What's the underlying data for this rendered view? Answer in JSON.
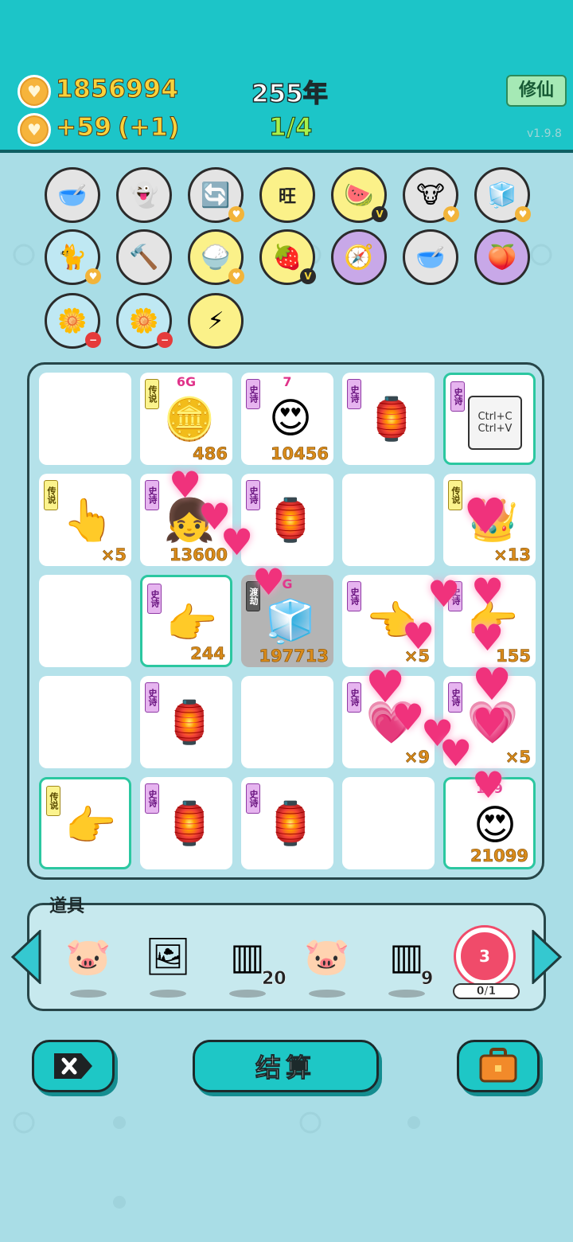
{
  "header": {
    "coins": "1856994",
    "income": "+59",
    "income_bonus": "(+1)",
    "year": "255年",
    "progress": "1/4",
    "cultivate_label": "修仙",
    "version": "v1.9.8"
  },
  "abilities": [
    {
      "name": "dog-food-bowl-icon",
      "glyph": "🥣",
      "bg": "gray",
      "badge": ""
    },
    {
      "name": "ghost-icon",
      "glyph": "👻",
      "bg": "gray",
      "badge": ""
    },
    {
      "name": "refresh-icon",
      "glyph": "🔄",
      "bg": "gray",
      "badge": "h"
    },
    {
      "name": "wang-text-icon",
      "glyph": "旺",
      "bg": "yellow",
      "badge": ""
    },
    {
      "name": "fruit-platter-icon",
      "glyph": "🍉",
      "bg": "yellow",
      "badge": "v"
    },
    {
      "name": "cow-toys-icon",
      "glyph": "🐮",
      "bg": "gray",
      "badge": "h"
    },
    {
      "name": "sugar-cubes-icon",
      "glyph": "🧊",
      "bg": "gray",
      "badge": "h"
    },
    {
      "name": "cat-back-icon",
      "glyph": "🐈",
      "bg": "blue",
      "badge": "h"
    },
    {
      "name": "hammer-icon",
      "glyph": "🔨",
      "bg": "gray",
      "badge": ""
    },
    {
      "name": "rice-bowl-icon",
      "glyph": "🍚",
      "bg": "yellow",
      "badge": "h"
    },
    {
      "name": "fruit-basket-icon",
      "glyph": "🍓",
      "bg": "yellow",
      "badge": "v"
    },
    {
      "name": "compass-icon",
      "glyph": "🧭",
      "bg": "purple",
      "badge": ""
    },
    {
      "name": "dog-food-bowl-icon-2",
      "glyph": "🥣",
      "bg": "gray",
      "badge": ""
    },
    {
      "name": "eyepatch-peach-icon",
      "glyph": "🍑",
      "bg": "purple",
      "badge": ""
    },
    {
      "name": "flower-pot-icon",
      "glyph": "🌼",
      "bg": "blue",
      "badge": "m"
    },
    {
      "name": "flower-pot-icon-2",
      "glyph": "🌼",
      "bg": "blue",
      "badge": "m"
    },
    {
      "name": "lightning-icon",
      "glyph": "⚡",
      "bg": "yellow",
      "badge": ""
    }
  ],
  "tags": {
    "legend": "传说",
    "epic": "史诗",
    "dujie": "渡劫"
  },
  "board": [
    {
      "tag": "",
      "glyph": "",
      "num": "",
      "top": ""
    },
    {
      "tag": "legend",
      "glyph": "🪙",
      "num": "486",
      "top": "6G"
    },
    {
      "tag": "epic",
      "glyph": "😍",
      "num": "10456",
      "top": "7"
    },
    {
      "tag": "epic",
      "glyph": "🏮",
      "num": "",
      "top": ""
    },
    {
      "tag": "epic",
      "glyph": "📋",
      "num": "",
      "top": "",
      "sel": true,
      "text": "Ctrl+C\nCtrl+V"
    },
    {
      "tag": "legend",
      "glyph": "👆",
      "num": "×5",
      "top": ""
    },
    {
      "tag": "epic",
      "glyph": "👧",
      "num": "13600",
      "top": ""
    },
    {
      "tag": "epic",
      "glyph": "🏮",
      "num": "",
      "top": ""
    },
    {
      "tag": "",
      "glyph": "",
      "num": "",
      "top": ""
    },
    {
      "tag": "legend",
      "glyph": "👑",
      "num": "×13",
      "top": ""
    },
    {
      "tag": "",
      "glyph": "",
      "num": "",
      "top": ""
    },
    {
      "tag": "epic",
      "glyph": "👉",
      "num": "244",
      "top": "",
      "sel": true
    },
    {
      "tag": "dujie",
      "glyph": "🧊",
      "num": "197713",
      "top": "G",
      "gray": true
    },
    {
      "tag": "epic",
      "glyph": "👈",
      "num": "×5",
      "top": ""
    },
    {
      "tag": "epic",
      "glyph": "👉",
      "num": "155",
      "top": ""
    },
    {
      "tag": "",
      "glyph": "",
      "num": "",
      "top": ""
    },
    {
      "tag": "epic",
      "glyph": "🏮",
      "num": "",
      "top": ""
    },
    {
      "tag": "",
      "glyph": "",
      "num": "",
      "top": ""
    },
    {
      "tag": "epic",
      "glyph": "💗",
      "num": "×9",
      "top": ""
    },
    {
      "tag": "epic",
      "glyph": "💗",
      "num": "×5",
      "top": ""
    },
    {
      "tag": "legend",
      "glyph": "👉",
      "num": "",
      "top": "",
      "sel": true
    },
    {
      "tag": "epic",
      "glyph": "🏮",
      "num": "",
      "top": ""
    },
    {
      "tag": "epic",
      "glyph": "🏮",
      "num": "",
      "top": ""
    },
    {
      "tag": "",
      "glyph": "",
      "num": "",
      "top": ""
    },
    {
      "tag": "",
      "glyph": "😍",
      "num": "21099",
      "top": "109",
      "sel": true
    }
  ],
  "items": {
    "label": "道具",
    "list": [
      {
        "name": "piggy-bank-icon",
        "glyph": "🐷",
        "count": ""
      },
      {
        "name": "picture-frame-icon",
        "glyph": "🖼",
        "count": ""
      },
      {
        "name": "triple-panel-icon",
        "glyph": "▥",
        "count": "20"
      },
      {
        "name": "piggy-bank-icon-2",
        "glyph": "🐷",
        "count": ""
      },
      {
        "name": "triple-card-icon",
        "glyph": "▥",
        "count": "9"
      },
      {
        "name": "target-icon",
        "glyph": "3",
        "count": "0/1"
      }
    ]
  },
  "buttons": {
    "settle": "结算"
  }
}
